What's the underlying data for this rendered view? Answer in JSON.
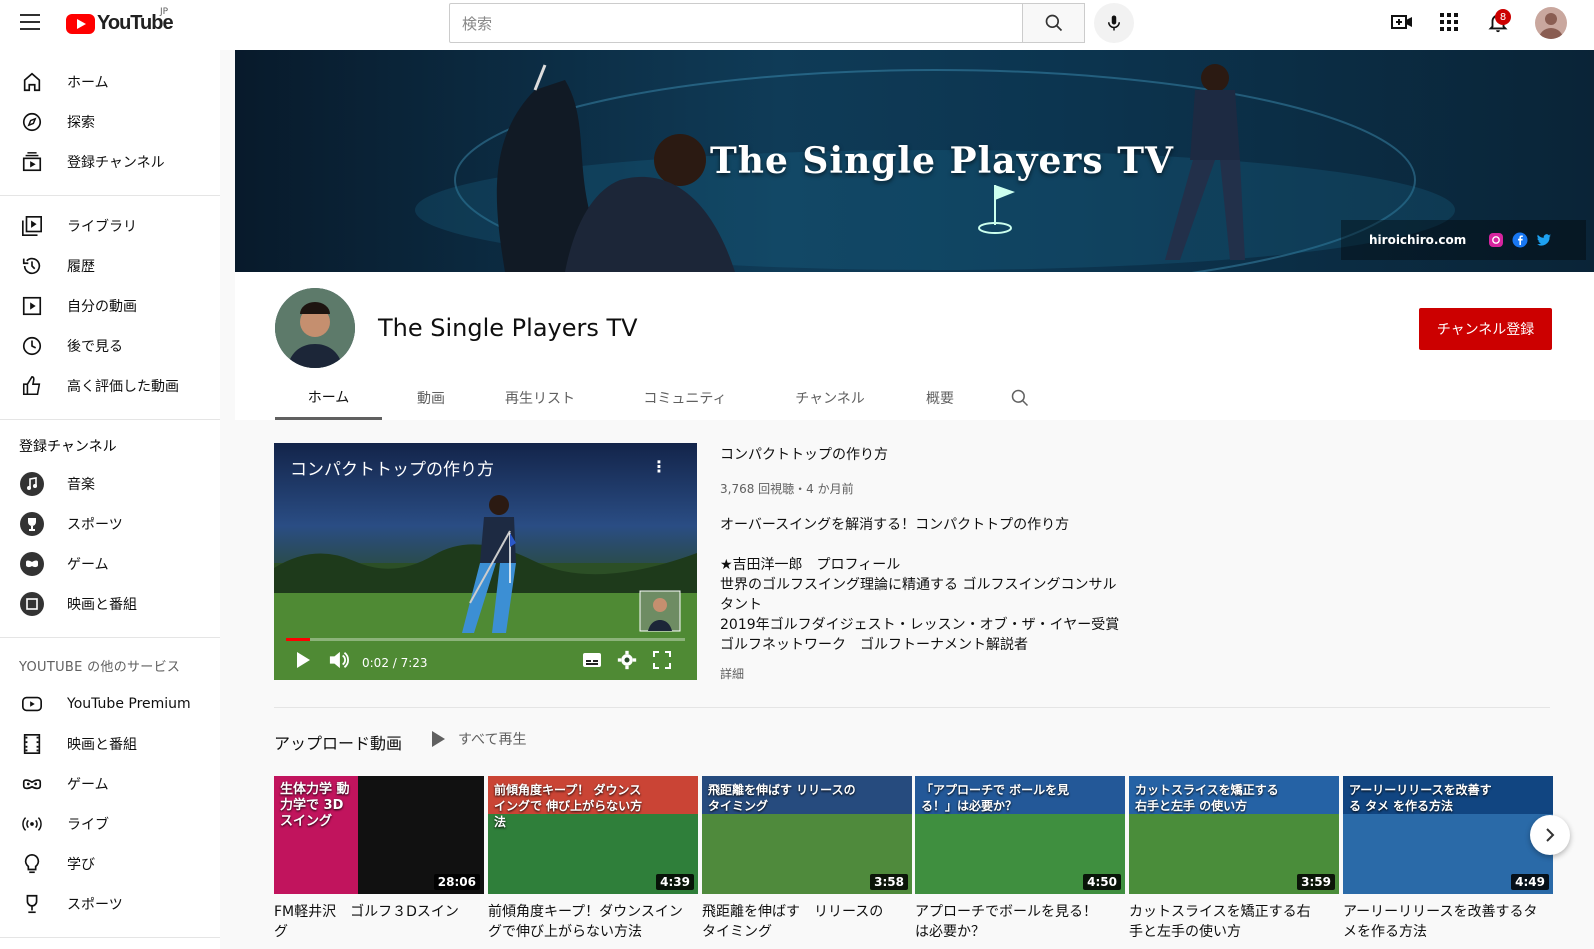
{
  "header": {
    "logo_text": "YouTube",
    "logo_region": "JP",
    "search_placeholder": "検索",
    "notification_count": "8"
  },
  "sidebar": {
    "main": [
      {
        "label": "ホーム",
        "icon": "home-icon"
      },
      {
        "label": "探索",
        "icon": "compass-icon"
      },
      {
        "label": "登録チャンネル",
        "icon": "subscriptions-icon"
      }
    ],
    "library": [
      {
        "label": "ライブラリ",
        "icon": "library-icon"
      },
      {
        "label": "履歴",
        "icon": "history-icon"
      },
      {
        "label": "自分の動画",
        "icon": "my-videos-icon"
      },
      {
        "label": "後で見る",
        "icon": "watch-later-icon"
      },
      {
        "label": "高く評価した動画",
        "icon": "thumbs-up-icon"
      }
    ],
    "subscriptions_heading": "登録チャンネル",
    "subscriptions": [
      {
        "label": "音楽",
        "icon": "music-icon"
      },
      {
        "label": "スポーツ",
        "icon": "trophy-icon"
      },
      {
        "label": "ゲーム",
        "icon": "gamepad-icon"
      },
      {
        "label": "映画と番組",
        "icon": "film-icon"
      }
    ],
    "more_heading": "YOUTUBE の他のサービス",
    "more": [
      {
        "label": "YouTube Premium",
        "icon": "youtube-icon"
      },
      {
        "label": "映画と番組",
        "icon": "film-strip-icon"
      },
      {
        "label": "ゲーム",
        "icon": "gamepad-icon"
      },
      {
        "label": "ライブ",
        "icon": "live-icon"
      },
      {
        "label": "学び",
        "icon": "bulb-icon"
      },
      {
        "label": "スポーツ",
        "icon": "trophy-icon"
      }
    ]
  },
  "banner": {
    "title": "The Single Players TV",
    "website": "hiroichiro.com"
  },
  "channel": {
    "name": "The Single Players TV",
    "subscribe_label": "チャンネル登録",
    "tabs": [
      "ホーム",
      "動画",
      "再生リスト",
      "コミュニティ",
      "チャンネル",
      "概要"
    ]
  },
  "featured": {
    "player_title": "コンパクトトップの作り方",
    "time": "0:02 / 7:23",
    "progress": 0.005,
    "title": "コンパクトトップの作り方",
    "meta": "3,768 回視聴・4 か月前",
    "description": [
      "オーバースイングを解消する！コンパクトトプの作り方",
      "",
      "★吉田洋一郎　プロフィール",
      "世界のゴルフスイング理論に精通する ゴルフスイングコンサル",
      "タント",
      "2019年ゴルフダイジェスト・レッスン・オブ・ザ・イヤー受賞",
      "ゴルフネットワーク　ゴルフトーナメント解説者"
    ],
    "more_label": "詳細"
  },
  "uploads": {
    "heading": "アップロード動画",
    "play_all": "すべて再生",
    "videos": [
      {
        "title": "FM軽井沢　ゴルフ３Dスイング",
        "duration": "28:06",
        "overlay": "生体力学 動力学で 3D スイング",
        "bg": "#111111",
        "accent": "#e0156b"
      },
      {
        "title": "前傾角度キープ！ダウンスイングで伸び上がらない方法",
        "duration": "4:39",
        "overlay": "前傾角度キープ！ ダウンスイングで 伸び上がらない方法",
        "bg": "#2f7f3a",
        "accent": "#e53935"
      },
      {
        "title": "飛距離を伸ばす　リリースのタイミング",
        "duration": "3:58",
        "overlay": "飛距離を伸ばす リリースのタイミング",
        "bg": "#4f8a3c",
        "accent": "#1e3f8a"
      },
      {
        "title": "アプローチでボールを見る！は必要か？",
        "duration": "4:50",
        "overlay": "「アプローチで ボールを見る！」は必要か？",
        "bg": "#3f8f3f",
        "accent": "#1f4fa8"
      },
      {
        "title": "カットスライスを矯正する右手と左手の使い方",
        "duration": "3:59",
        "overlay": "カットスライスを矯正する 右手と左手 の使い方",
        "bg": "#4a8d3a",
        "accent": "#1e5bb8"
      },
      {
        "title": "アーリーリリースを改善するタメを作る方法",
        "duration": "4:49",
        "overlay": "アーリーリリースを改善する タメ を作る方法",
        "bg": "#2a6aa8",
        "accent": "#0d3e7a"
      }
    ]
  }
}
